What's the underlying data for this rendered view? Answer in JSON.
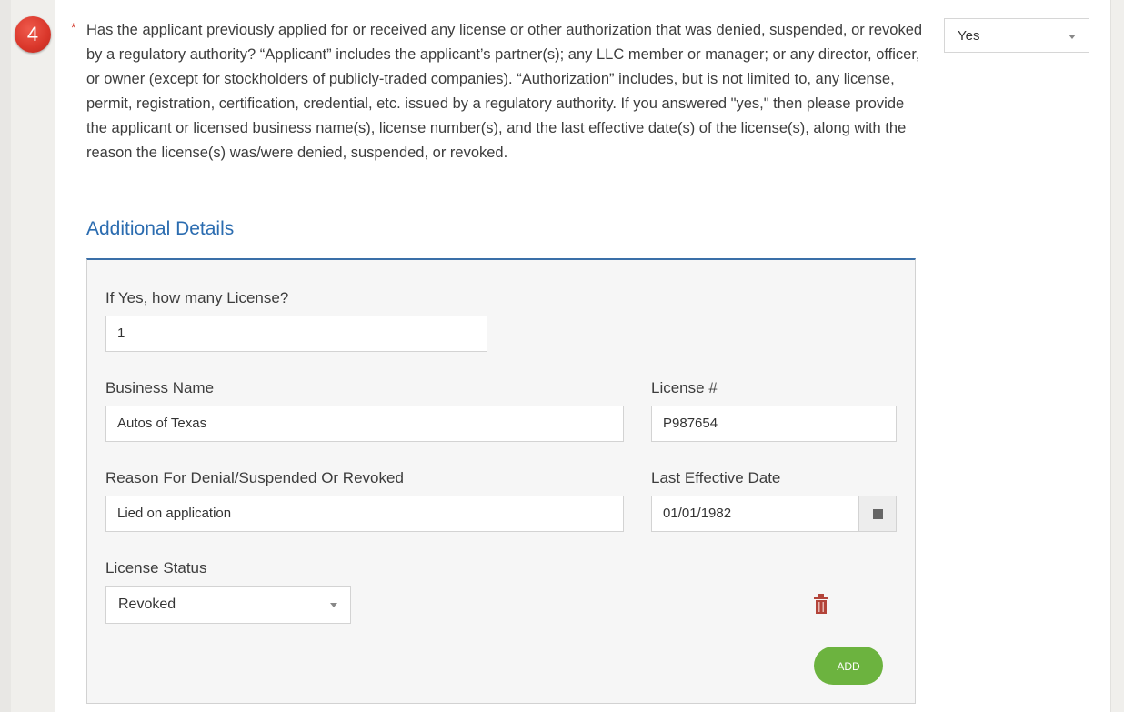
{
  "question": {
    "number": "4",
    "required_mark": "*",
    "text": "Has the applicant previously applied for or received any license or other authorization that was denied, suspended, or revoked by a regulatory authority? “Applicant” includes the applicant’s partner(s); any LLC member or manager; or any director, officer, or owner (except for stockholders of publicly-traded companies). “Authorization” includes, but is not limited to, any license, permit, registration, certification, credential, etc. issued by a regulatory authority. If you answered \"yes,\" then please provide the applicant or licensed business name(s), license number(s), and the last effective date(s) of the license(s), along with the reason the license(s) was/were denied, suspended, or revoked.",
    "answer": "Yes"
  },
  "details": {
    "title": "Additional Details",
    "count_label": "If Yes, how many License?",
    "count_value": "1",
    "business_name_label": "Business Name",
    "business_name_value": "Autos of Texas",
    "license_no_label": "License #",
    "license_no_value": "P987654",
    "reason_label": "Reason For Denial/Suspended Or Revoked",
    "reason_value": "Lied on application",
    "date_label": "Last Effective Date",
    "date_value": "01/01/1982",
    "status_label": "License Status",
    "status_value": "Revoked",
    "add_label": "ADD"
  },
  "colors": {
    "accent_blue": "#2b6cb0",
    "add_green": "#6cb33f",
    "badge_red": "#d9362a",
    "trash_red": "#b3443a"
  },
  "icons": {
    "calendar": "calendar-icon",
    "delete": "trash-icon",
    "dropdown": "chevron-down-icon"
  }
}
